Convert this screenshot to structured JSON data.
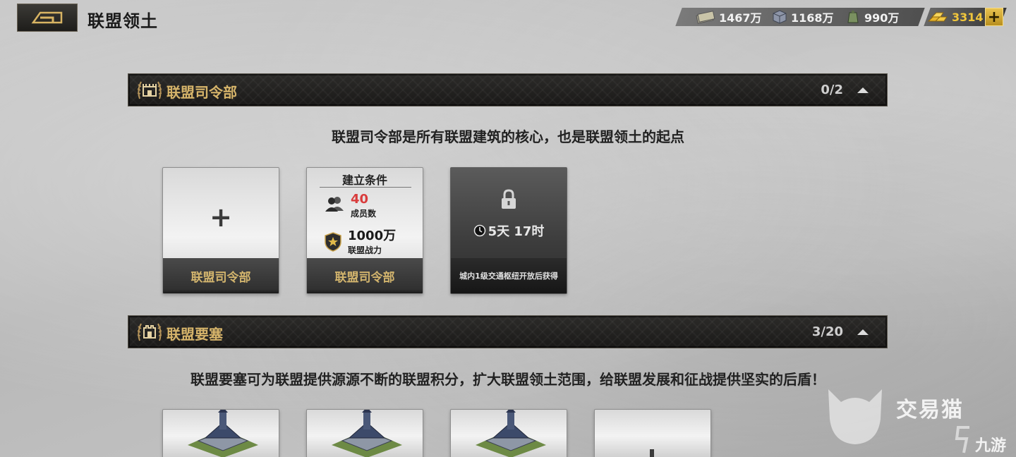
{
  "header": {
    "title": "联盟领土"
  },
  "resources": [
    {
      "icon": "cash-icon",
      "value": "1467万"
    },
    {
      "icon": "steel-icon",
      "value": "1168万"
    },
    {
      "icon": "oil-icon",
      "value": "990万"
    }
  ],
  "gold": {
    "icon": "gold-bars-icon",
    "value": "3314",
    "plus": "+"
  },
  "sections": [
    {
      "title": "联盟司令部",
      "count": "0/2",
      "description": "联盟司令部是所有联盟建筑的核心，也是联盟领土的起点",
      "cards": [
        {
          "type": "add",
          "plus": "+",
          "label": "联盟司令部"
        },
        {
          "type": "requirements",
          "heading": "建立条件",
          "req1_value": "40",
          "req1_label": "成员数",
          "req2_value": "1000万",
          "req2_label": "联盟战力",
          "label": "联盟司令部"
        },
        {
          "type": "locked",
          "timer": "5天 17时",
          "note": "城内1级交通枢纽开放后获得"
        }
      ]
    },
    {
      "title": "联盟要塞",
      "count": "3/20",
      "description": "联盟要塞可为联盟提供源源不断的联盟积分，扩大联盟领土范围，给联盟发展和征战提供坚实的后盾！",
      "cards": [
        {
          "type": "building"
        },
        {
          "type": "building"
        },
        {
          "type": "building"
        },
        {
          "type": "add"
        }
      ]
    }
  ],
  "watermark": {
    "brand": "交易猫",
    "sub": "九游"
  },
  "colors": {
    "gold": "#d6b46a",
    "red": "#d93c3c",
    "header_bg": "#1f1e1c"
  }
}
